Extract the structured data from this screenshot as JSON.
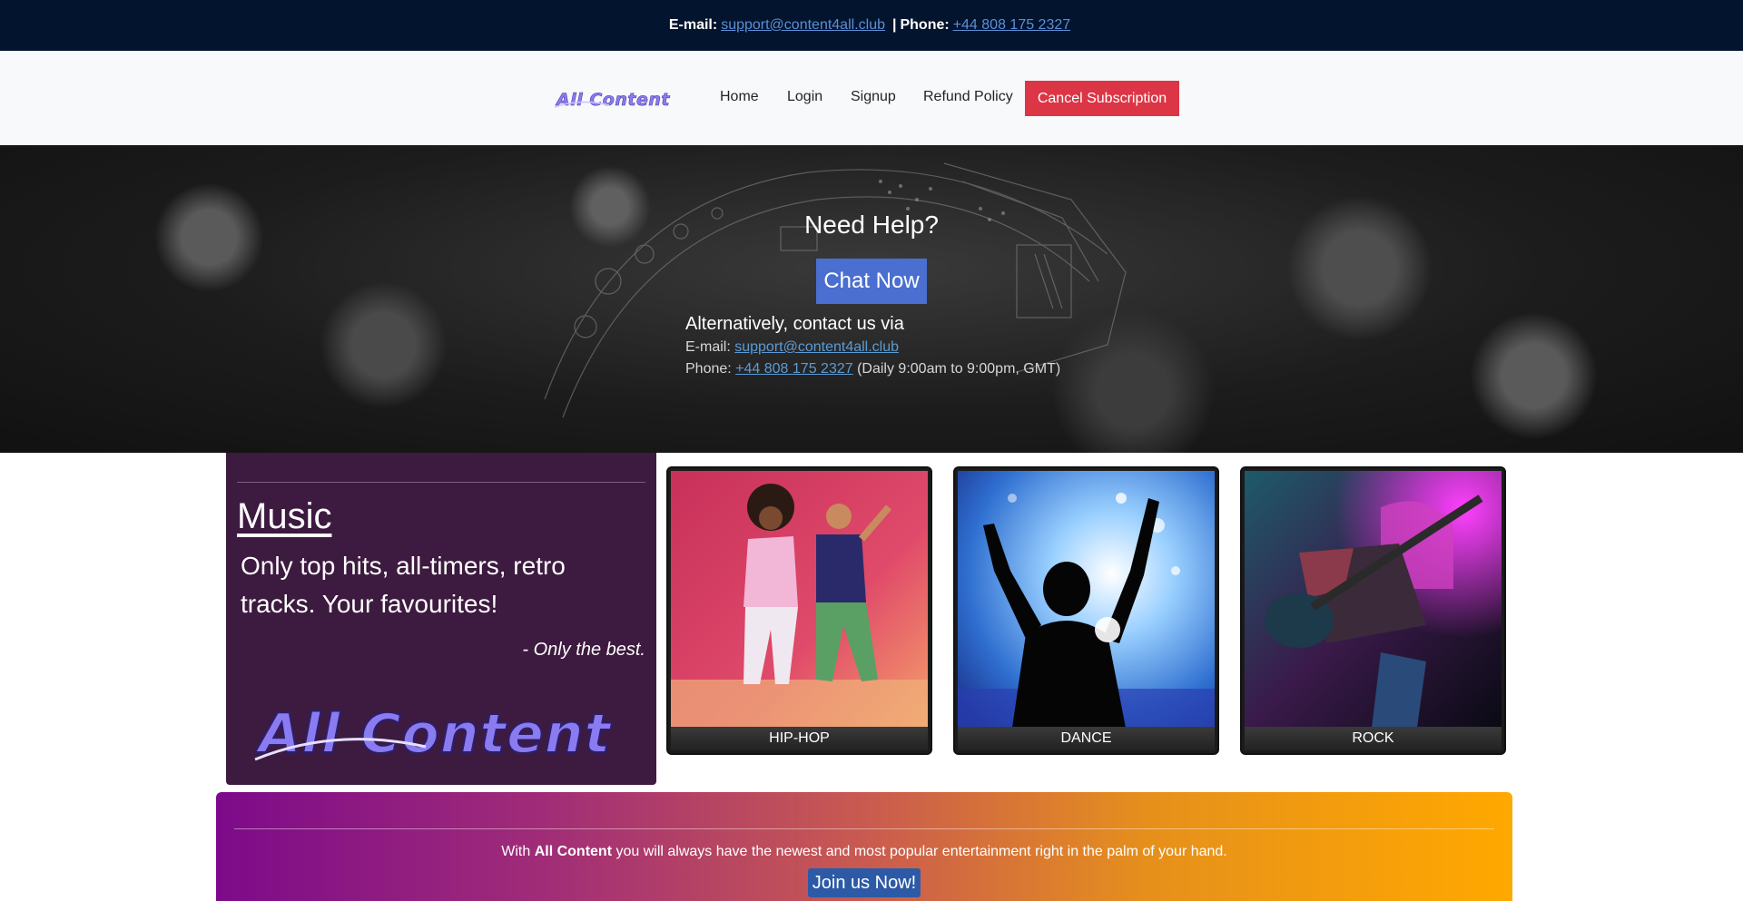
{
  "topbar": {
    "email_label": "E-mail:",
    "email": "support@content4all.club",
    "separator": "|",
    "phone_label": "Phone:",
    "phone": "+44 808 175 2327"
  },
  "nav": {
    "logo_text": "All Content",
    "items": [
      "Home",
      "Login",
      "Signup",
      "Refund Policy"
    ],
    "cancel_label": "Cancel Subscription"
  },
  "hero": {
    "title": "Need Help?",
    "chat_label": "Chat Now",
    "alt_title": "Alternatively, contact us via",
    "email_label": "E-mail:",
    "email": "support@content4all.club",
    "phone_label": "Phone:",
    "phone": "+44 808 175 2327",
    "hours": "(Daily 9:00am to 9:00pm, GMT)"
  },
  "music": {
    "title": "Music",
    "description": "Only top hits, all-timers, retro tracks. Your favourites!",
    "quote": "- Only the best.",
    "logo_text": "All Content"
  },
  "genres": [
    {
      "label": "HIP-HOP"
    },
    {
      "label": "DANCE"
    },
    {
      "label": "ROCK"
    }
  ],
  "banner": {
    "prefix": "With",
    "brand": "All Content",
    "suffix": "you will always have the newest and most popular entertainment right in the palm of your hand.",
    "join_label": "Join us Now!"
  },
  "colors": {
    "topbar_bg": "#03142e",
    "cancel_btn": "#dc3545",
    "chat_btn": "#4a6fd0",
    "music_panel": "#3d1a3f",
    "join_btn": "#2d5aa6",
    "logo_purple": "#8b7bf0"
  }
}
